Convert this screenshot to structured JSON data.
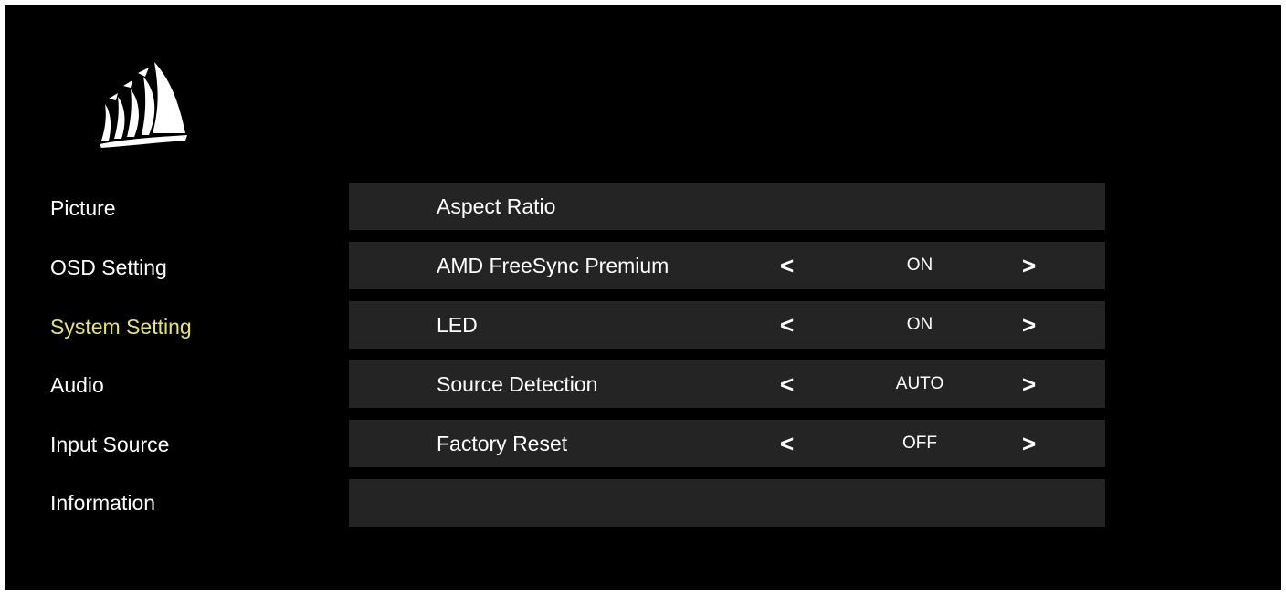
{
  "theme": {
    "accent": "#e3e36e",
    "row_background": "#242424",
    "background": "#000000"
  },
  "logo": {
    "icon": "corsair-sails-logo"
  },
  "sidebar": {
    "items": [
      {
        "label": "Picture",
        "active": false
      },
      {
        "label": "OSD Setting",
        "active": false
      },
      {
        "label": "System Setting",
        "active": true
      },
      {
        "label": "Audio",
        "active": false
      },
      {
        "label": "Input Source",
        "active": false
      },
      {
        "label": "Information",
        "active": false
      }
    ]
  },
  "settings": {
    "rows": [
      {
        "label": "Aspect Ratio"
      },
      {
        "label": "AMD FreeSync Premium",
        "left_arrow": "<",
        "value": "ON",
        "right_arrow": ">"
      },
      {
        "label": "LED",
        "left_arrow": "<",
        "value": "ON",
        "right_arrow": ">"
      },
      {
        "label": "Source Detection",
        "left_arrow": "<",
        "value": "AUTO",
        "right_arrow": ">"
      },
      {
        "label": "Factory Reset",
        "left_arrow": "<",
        "value": "OFF",
        "right_arrow": ">"
      },
      {
        "label": ""
      }
    ]
  }
}
